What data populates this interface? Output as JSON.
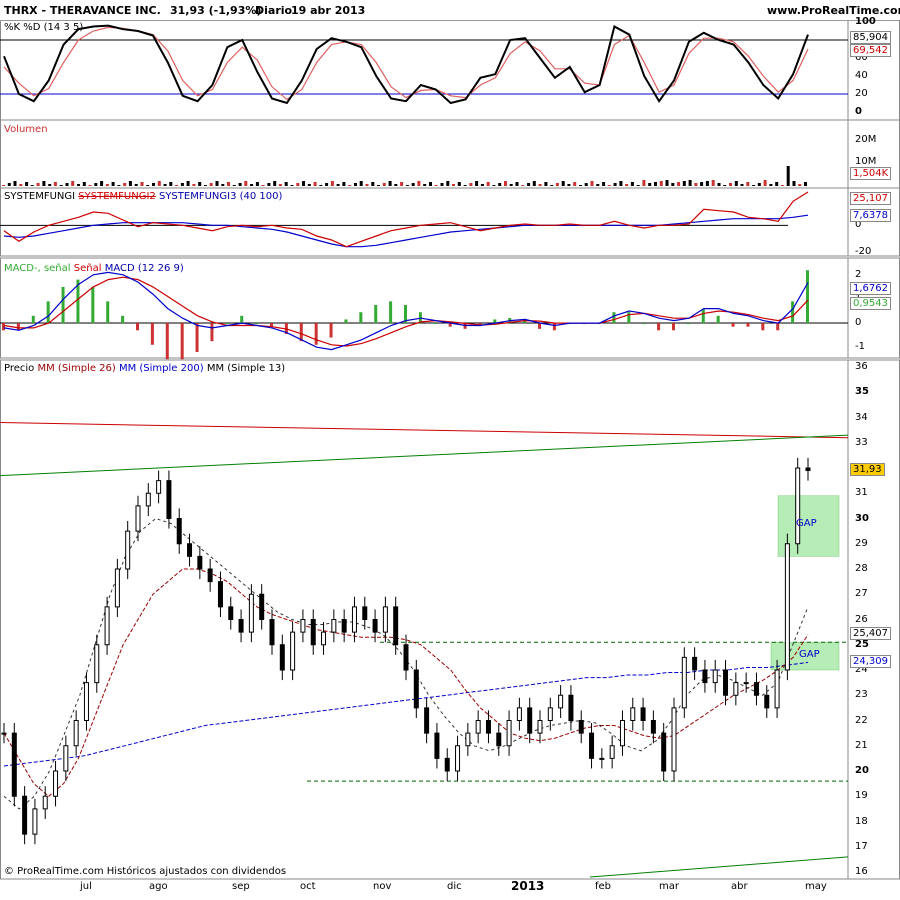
{
  "header": {
    "title": "THRX - THERAVANCE INC.",
    "quote": "31,93 (-1,93%)",
    "period": "Diario",
    "date": "19 abr 2013",
    "site": "www.ProRealTime.com"
  },
  "footer": "© ProRealTime.com  Históricos ajustados con dividendos",
  "colors": {
    "price_line": "#000000",
    "ma26": "#990000",
    "ma200": "#0000cc",
    "ma13": "#000000",
    "green": "#008000",
    "red": "#cc0000",
    "gap_fill": "#b6ecb6",
    "macd_green": "#33aa33"
  },
  "chart_data": [
    {
      "type": "line",
      "panel": "stochastic",
      "title": "%K %D (14 3 5)",
      "ylim": [
        0,
        100
      ],
      "ticks": [
        "100",
        "80",
        "60",
        "40",
        "20",
        "0"
      ],
      "levels": [
        80,
        20
      ],
      "last_values": [
        "85,904",
        "69,542"
      ],
      "series": [
        {
          "name": "%K",
          "values": [
            62,
            20,
            12,
            35,
            75,
            92,
            95,
            96,
            92,
            90,
            85,
            55,
            18,
            12,
            30,
            72,
            80,
            45,
            15,
            10,
            35,
            70,
            82,
            78,
            72,
            40,
            15,
            12,
            30,
            25,
            10,
            14,
            38,
            42,
            80,
            82,
            60,
            38,
            50,
            22,
            30,
            95,
            86,
            40,
            12,
            35,
            78,
            88,
            80,
            75,
            55,
            30,
            15,
            42,
            86
          ]
        },
        {
          "name": "%D",
          "values": [
            50,
            32,
            18,
            26,
            55,
            80,
            90,
            94,
            93,
            90,
            86,
            68,
            35,
            18,
            25,
            55,
            72,
            58,
            28,
            14,
            25,
            55,
            75,
            78,
            75,
            55,
            28,
            16,
            24,
            25,
            18,
            16,
            30,
            38,
            65,
            78,
            68,
            48,
            48,
            32,
            30,
            75,
            85,
            55,
            22,
            30,
            65,
            82,
            82,
            78,
            62,
            40,
            22,
            35,
            70
          ]
        }
      ]
    },
    {
      "type": "bar",
      "panel": "volume",
      "title": "Volumen",
      "ticks": [
        "20M",
        "10M"
      ],
      "last_value": "1,504K"
    },
    {
      "type": "line",
      "panel": "systemfungi",
      "title_parts": [
        "SYSTEMFUNGI",
        "SYSTEMFUNGI2",
        "SYSTEMFUNGI3 (40 100)"
      ],
      "ylim": [
        -20,
        25
      ],
      "ticks": [
        "20",
        "0",
        "-20"
      ],
      "last_values": [
        "25,107",
        "7,6378"
      ],
      "series": [
        {
          "name": "SYSTEMFUNGI2",
          "values": [
            -4,
            -12,
            -5,
            0,
            3,
            6,
            10,
            9,
            4,
            -1,
            2,
            1,
            0,
            -2,
            -4,
            -1,
            0,
            -1,
            0,
            -2,
            -3,
            -8,
            -11,
            -16,
            -12,
            -8,
            -4,
            -2,
            0,
            1,
            2,
            -1,
            -4,
            -2,
            0,
            1,
            0,
            0,
            1,
            0,
            0,
            3,
            0,
            -2,
            0,
            0,
            1,
            12,
            11,
            10,
            6,
            5,
            3,
            18,
            25
          ]
        },
        {
          "name": "SYSTEMFUNGI3",
          "values": [
            -8,
            -9,
            -8,
            -6,
            -4,
            -2,
            0,
            1,
            2,
            2,
            2,
            2,
            2,
            1,
            0,
            0,
            -1,
            -2,
            -3,
            -5,
            -8,
            -11,
            -14,
            -16,
            -16,
            -15,
            -13,
            -11,
            -9,
            -7,
            -5,
            -4,
            -3,
            -2,
            -1,
            0,
            0,
            0,
            0,
            0,
            0,
            0,
            0,
            0,
            0,
            1,
            2,
            3,
            4,
            5,
            5,
            5,
            5,
            6,
            7.6
          ]
        }
      ]
    },
    {
      "type": "line",
      "panel": "macd",
      "title_parts": [
        "MACD-, señal",
        "Señal",
        "MACD (12 26 9)"
      ],
      "ylim": [
        -1.2,
        2.2
      ],
      "ticks": [
        "2",
        "1",
        "0",
        "-1"
      ],
      "last_values": [
        "1,6762",
        "0,9543"
      ],
      "series": [
        {
          "name": "MACD",
          "values": [
            -0.2,
            -0.3,
            -0.1,
            0.3,
            1,
            1.6,
            2,
            2.1,
            2,
            1.7,
            1.2,
            0.6,
            0.2,
            -0.1,
            -0.2,
            -0.1,
            0,
            -0.1,
            -0.2,
            -0.4,
            -0.7,
            -1,
            -1.1,
            -0.9,
            -0.7,
            -0.4,
            -0.1,
            0.1,
            0.2,
            0.1,
            0,
            -0.1,
            -0.1,
            0,
            0.1,
            0.15,
            0,
            -0.1,
            0,
            0,
            0,
            0.3,
            0.5,
            0.4,
            0.2,
            0.1,
            0.2,
            0.6,
            0.6,
            0.4,
            0.3,
            0.1,
            0,
            0.6,
            1.68
          ]
        },
        {
          "name": "Señal",
          "values": [
            -0.1,
            -0.2,
            -0.2,
            0,
            0.5,
            1,
            1.5,
            1.8,
            1.9,
            1.8,
            1.5,
            1.1,
            0.7,
            0.3,
            0.05,
            -0.1,
            -0.1,
            -0.1,
            -0.15,
            -0.25,
            -0.45,
            -0.7,
            -0.9,
            -0.95,
            -0.85,
            -0.65,
            -0.4,
            -0.15,
            0.05,
            0.1,
            0.05,
            -0.02,
            -0.08,
            -0.05,
            0.03,
            0.1,
            0.08,
            0,
            0,
            0,
            0,
            0.15,
            0.35,
            0.4,
            0.3,
            0.2,
            0.2,
            0.4,
            0.5,
            0.45,
            0.35,
            0.2,
            0.1,
            0.3,
            0.95
          ]
        }
      ]
    },
    {
      "type": "line",
      "panel": "price",
      "title_parts": [
        "Precio",
        "MM (Simple 26)",
        "MM (Simple 200)",
        "MM (Simple 13)"
      ],
      "ylim": [
        16,
        36
      ],
      "ticks": [
        "36",
        "35",
        "34",
        "33",
        "32",
        "31",
        "30",
        "29",
        "28",
        "27",
        "26",
        "25",
        "24",
        "23",
        "22",
        "21",
        "20",
        "19",
        "18",
        "17",
        "16"
      ],
      "bold_ticks": [
        "35",
        "30",
        "25",
        "20"
      ],
      "last_values": [
        "31,93",
        "25,407",
        "24,309"
      ],
      "x_labels": [
        "jul",
        "ago",
        "sep",
        "oct",
        "nov",
        "dic",
        "2013",
        "feb",
        "mar",
        "abr",
        "may"
      ],
      "gap_label": "GAP",
      "series": [
        {
          "name": "Precio",
          "values": [
            21.5,
            19,
            17.5,
            18.5,
            19,
            20,
            21,
            22,
            23.5,
            25,
            26.5,
            28,
            29.5,
            30.5,
            31,
            31.5,
            30,
            29,
            28.5,
            28,
            27.5,
            26.5,
            26,
            25.5,
            27,
            26,
            25,
            24,
            25.5,
            26,
            25,
            25.5,
            26,
            25.5,
            26.5,
            26,
            25.5,
            26.5,
            25,
            24,
            22.5,
            21.5,
            20.5,
            20,
            21,
            21.5,
            22,
            21.5,
            21,
            22,
            22.5,
            21.5,
            22,
            22.5,
            23,
            22,
            21.5,
            20.5,
            20.5,
            21,
            22,
            22.5,
            22,
            21.5,
            20,
            22.5,
            24.5,
            24,
            23.5,
            24,
            23,
            23.5,
            23.5,
            23,
            22.5,
            24,
            29,
            32,
            31.9
          ]
        },
        {
          "name": "MM (Simple 26)",
          "values": [
            21.5,
            20.5,
            19.5,
            19,
            19.5,
            20.5,
            22,
            23.5,
            25,
            26,
            27,
            27.5,
            28,
            28,
            27.8,
            27.5,
            27,
            26.5,
            26.2,
            26,
            25.8,
            25.6,
            25.5,
            25.4,
            25.3,
            25.3,
            25.3,
            25.2,
            25,
            24.5,
            24,
            23.2,
            22.5,
            22,
            21.5,
            21.3,
            21.2,
            21.3,
            21.5,
            21.7,
            21.8,
            21.8,
            21.6,
            21.4,
            21.3,
            21.4,
            21.8,
            22.2,
            22.6,
            23,
            23.3,
            23.6,
            24,
            24.5,
            25.4
          ]
        },
        {
          "name": "MM (Simple 200)",
          "values": [
            20.2,
            20.3,
            20.4,
            20.5,
            20.6,
            20.8,
            21,
            21.2,
            21.4,
            21.6,
            21.8,
            21.9,
            22,
            22.1,
            22.2,
            22.3,
            22.4,
            22.5,
            22.6,
            22.7,
            22.8,
            22.9,
            23,
            23.1,
            23.2,
            23.3,
            23.4,
            23.5,
            23.6,
            23.7,
            23.7,
            23.8,
            23.8,
            23.9,
            23.9,
            24,
            24,
            24.1,
            24.1,
            24.2,
            24.3
          ]
        },
        {
          "name": "MM (Simple 13)",
          "values": [
            19,
            18.5,
            19,
            20,
            21.5,
            23,
            25,
            27,
            28.5,
            29.5,
            30,
            29.8,
            29.3,
            28.8,
            28.3,
            27.8,
            27.3,
            26.8,
            26.3,
            26,
            25.8,
            25.8,
            25.9,
            25.9,
            25.7,
            25.4,
            24.8,
            24,
            23,
            22.2,
            21.5,
            21,
            20.8,
            21,
            21.3,
            21.6,
            21.8,
            21.9,
            22,
            21.9,
            21.5,
            21,
            20.8,
            21.2,
            22,
            23,
            23.6,
            23.8,
            23.6,
            23.3,
            23,
            23.5,
            25,
            26.5
          ]
        }
      ]
    }
  ]
}
